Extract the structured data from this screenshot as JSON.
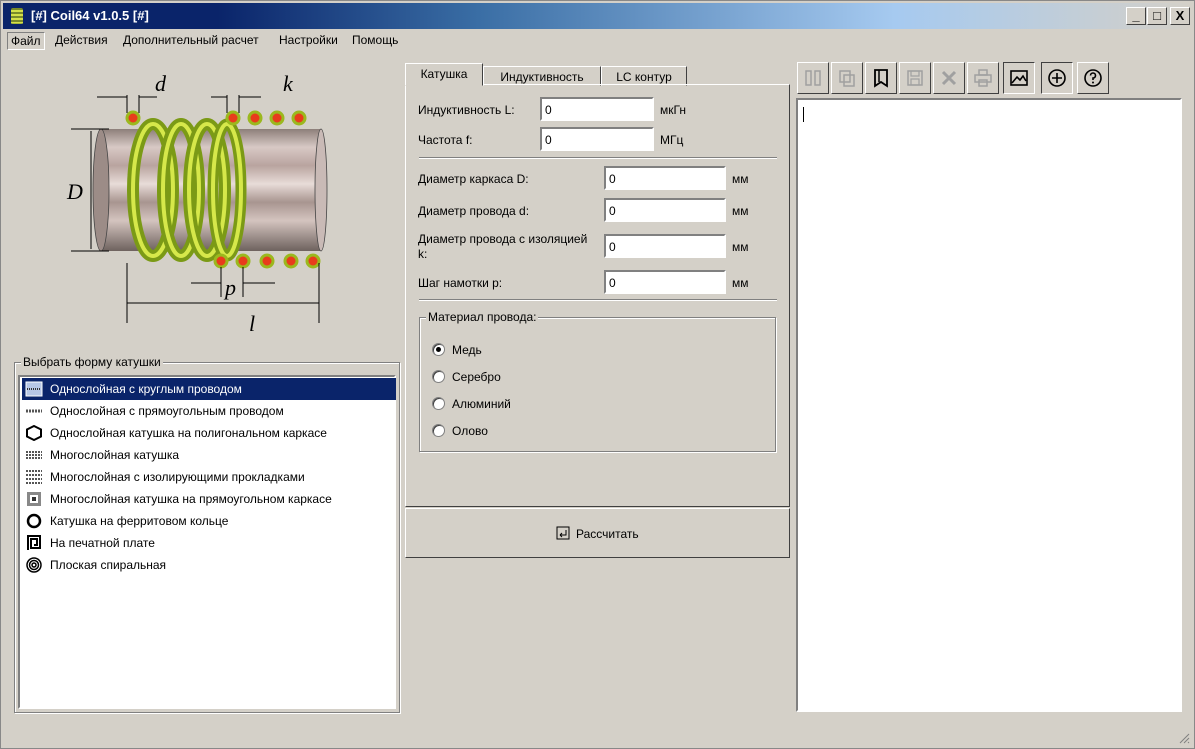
{
  "window": {
    "title": "[#] Coil64 v1.0.5 [#]",
    "minimize": "_",
    "maximize": "□",
    "close": "X"
  },
  "menu": {
    "items": [
      "Файл",
      "Действия",
      "Дополнительный расчет",
      "Настройки",
      "Помощь"
    ]
  },
  "diagram": {
    "label_d": "d",
    "label_k": "k",
    "label_D": "D",
    "label_p": "p",
    "label_l": "l"
  },
  "coil_shape": {
    "caption": "Выбрать форму катушки",
    "items": [
      {
        "label": "Однослойная с круглым проводом",
        "icon": "single-layer-round-icon",
        "selected": true
      },
      {
        "label": "Однослойная с прямоугольным проводом",
        "icon": "single-layer-rect-icon",
        "selected": false
      },
      {
        "label": "Однослойная катушка на полигональном каркасе",
        "icon": "polygon-icon",
        "selected": false
      },
      {
        "label": "Многослойная катушка",
        "icon": "multilayer-icon",
        "selected": false
      },
      {
        "label": "Многослойная с изолирующими прокладками",
        "icon": "multilayer-gaps-icon",
        "selected": false
      },
      {
        "label": "Многослойная катушка на прямоугольном каркасе",
        "icon": "rect-frame-icon",
        "selected": false
      },
      {
        "label": "Катушка на ферритовом кольце",
        "icon": "ferrite-ring-icon",
        "selected": false
      },
      {
        "label": "На печатной плате",
        "icon": "pcb-icon",
        "selected": false
      },
      {
        "label": "Плоская спиральная",
        "icon": "flat-spiral-icon",
        "selected": false
      }
    ]
  },
  "tabs": {
    "coil": "Катушка",
    "inductance": "Индуктивность",
    "lc": "LC контур"
  },
  "form": {
    "inductance_label": "Индуктивность L:",
    "inductance_value": "0",
    "inductance_unit": "мкГн",
    "frequency_label": "Частота f:",
    "frequency_value": "0",
    "frequency_unit": "МГц",
    "diameter_label": "Диаметр каркаса D:",
    "diameter_value": "0",
    "diameter_unit": "мм",
    "wire_label": "Диаметр провода d:",
    "wire_value": "0",
    "wire_unit": "мм",
    "wire_ins_label_1": "Диаметр провода с изоляцией",
    "wire_ins_label_2": "k:",
    "wire_ins_value": "0",
    "wire_ins_unit": "мм",
    "pitch_label": "Шаг намотки p:",
    "pitch_value": "0",
    "pitch_unit": "мм"
  },
  "material": {
    "caption": "Материал провода:",
    "options": [
      {
        "label": "Медь",
        "checked": true
      },
      {
        "label": "Серебро",
        "checked": false
      },
      {
        "label": "Алюминий",
        "checked": false
      },
      {
        "label": "Олово",
        "checked": false
      }
    ]
  },
  "calculate": {
    "label": "Рассчитать"
  },
  "colors": {
    "selection": "#0a246a",
    "window_bg": "#d4d0c8",
    "coil_wire": "#9bb81e",
    "wire_dot": "#e83c1c"
  }
}
